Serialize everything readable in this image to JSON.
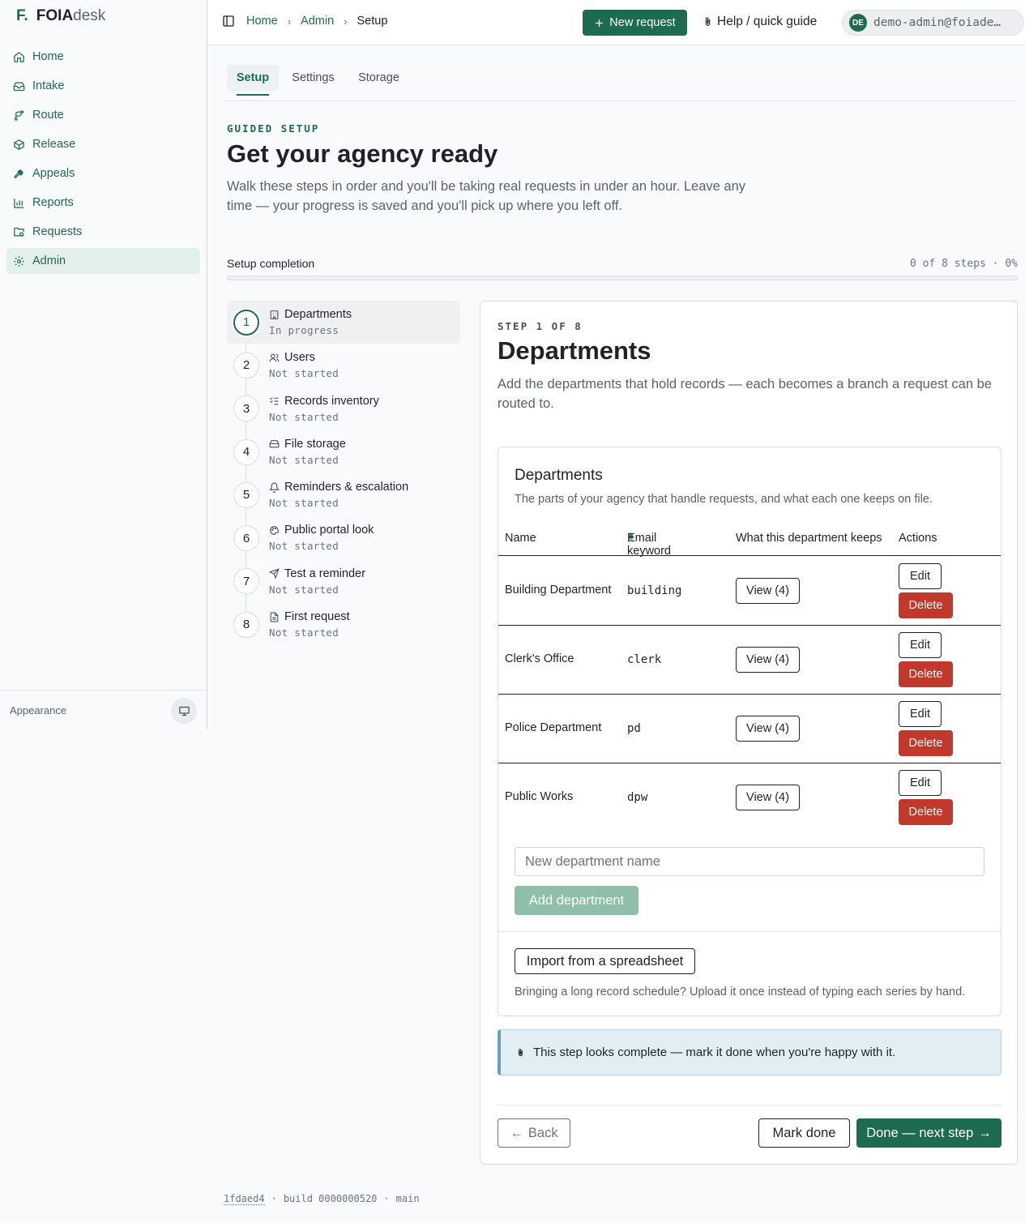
{
  "brand": {
    "mark": "F.",
    "bold": "FOIA",
    "light": "desk"
  },
  "sidebar": {
    "items": [
      {
        "label": "Home",
        "icon": "home-icon"
      },
      {
        "label": "Intake",
        "icon": "inbox-icon"
      },
      {
        "label": "Route",
        "icon": "route-icon"
      },
      {
        "label": "Release",
        "icon": "package-icon"
      },
      {
        "label": "Appeals",
        "icon": "gavel-icon"
      },
      {
        "label": "Reports",
        "icon": "bar-chart-icon"
      },
      {
        "label": "Requests",
        "icon": "folder-search-icon"
      },
      {
        "label": "Admin",
        "icon": "gear-icon",
        "active": true
      }
    ],
    "appearance_label": "Appearance"
  },
  "topbar": {
    "breadcrumb": [
      "Home",
      "Admin",
      "Setup"
    ],
    "new_request": "New request",
    "help": "Help / quick guide",
    "user_initials": "DE",
    "user_email": "demo-admin@foiade…"
  },
  "tabs": [
    "Setup",
    "Settings",
    "Storage"
  ],
  "hero": {
    "kicker": "GUIDED SETUP",
    "title": "Get your agency ready",
    "lede": "Walk these steps in order and you'll be taking real requests in under an hour. Leave any time — your progress is saved and you'll pick up where you left off."
  },
  "progress": {
    "label": "Setup completion",
    "count": "0 of 8 steps · 0%",
    "fraction": 0
  },
  "steps": [
    {
      "num": "1",
      "title": "Departments",
      "status": "In progress",
      "icon": "building-icon"
    },
    {
      "num": "2",
      "title": "Users",
      "status": "Not started",
      "icon": "users-icon"
    },
    {
      "num": "3",
      "title": "Records inventory",
      "status": "Not started",
      "icon": "checklist-icon"
    },
    {
      "num": "4",
      "title": "File storage",
      "status": "Not started",
      "icon": "hard-drive-icon"
    },
    {
      "num": "5",
      "title": "Reminders & escalation",
      "status": "Not started",
      "icon": "bell-icon"
    },
    {
      "num": "6",
      "title": "Public portal look",
      "status": "Not started",
      "icon": "palette-icon"
    },
    {
      "num": "7",
      "title": "Test a reminder",
      "status": "Not started",
      "icon": "send-icon"
    },
    {
      "num": "8",
      "title": "First request",
      "status": "Not started",
      "icon": "file-icon"
    }
  ],
  "panel": {
    "kicker": "STEP 1 OF 8",
    "title": "Departments",
    "lede": "Add the departments that hold records — each becomes a branch a request can be routed to.",
    "card": {
      "title": "Departments",
      "subtitle": "The parts of your agency that handle requests, and what each one keeps on file.",
      "columns": [
        "Name",
        "Email keyword",
        "What this department keeps",
        "Actions"
      ],
      "rows": [
        {
          "name": "Building Department",
          "keyword": "building",
          "view": "View (4)",
          "edit": "Edit",
          "delete": "Delete"
        },
        {
          "name": "Clerk's Office",
          "keyword": "clerk",
          "view": "View (4)",
          "edit": "Edit",
          "delete": "Delete"
        },
        {
          "name": "Police Department",
          "keyword": "pd",
          "view": "View (4)",
          "edit": "Edit",
          "delete": "Delete"
        },
        {
          "name": "Public Works",
          "keyword": "dpw",
          "view": "View (4)",
          "edit": "Edit",
          "delete": "Delete"
        }
      ],
      "new_placeholder": "New department name",
      "add_label": "Add department",
      "import_label": "Import from a spreadsheet",
      "import_hint": "Bringing a long record schedule? Upload it once instead of typing each series by hand."
    },
    "notice": "This step looks complete — mark it done when you're happy with it.",
    "back": "Back",
    "mark_done": "Mark done",
    "done_next": "Done — next step"
  },
  "footer": {
    "hash": "1fdaed4",
    "build": "build 0000000520",
    "branch": "main"
  },
  "colors": {
    "accent": "#1d6b50",
    "danger": "#c0392b",
    "notice_bg": "#e1eff5"
  }
}
